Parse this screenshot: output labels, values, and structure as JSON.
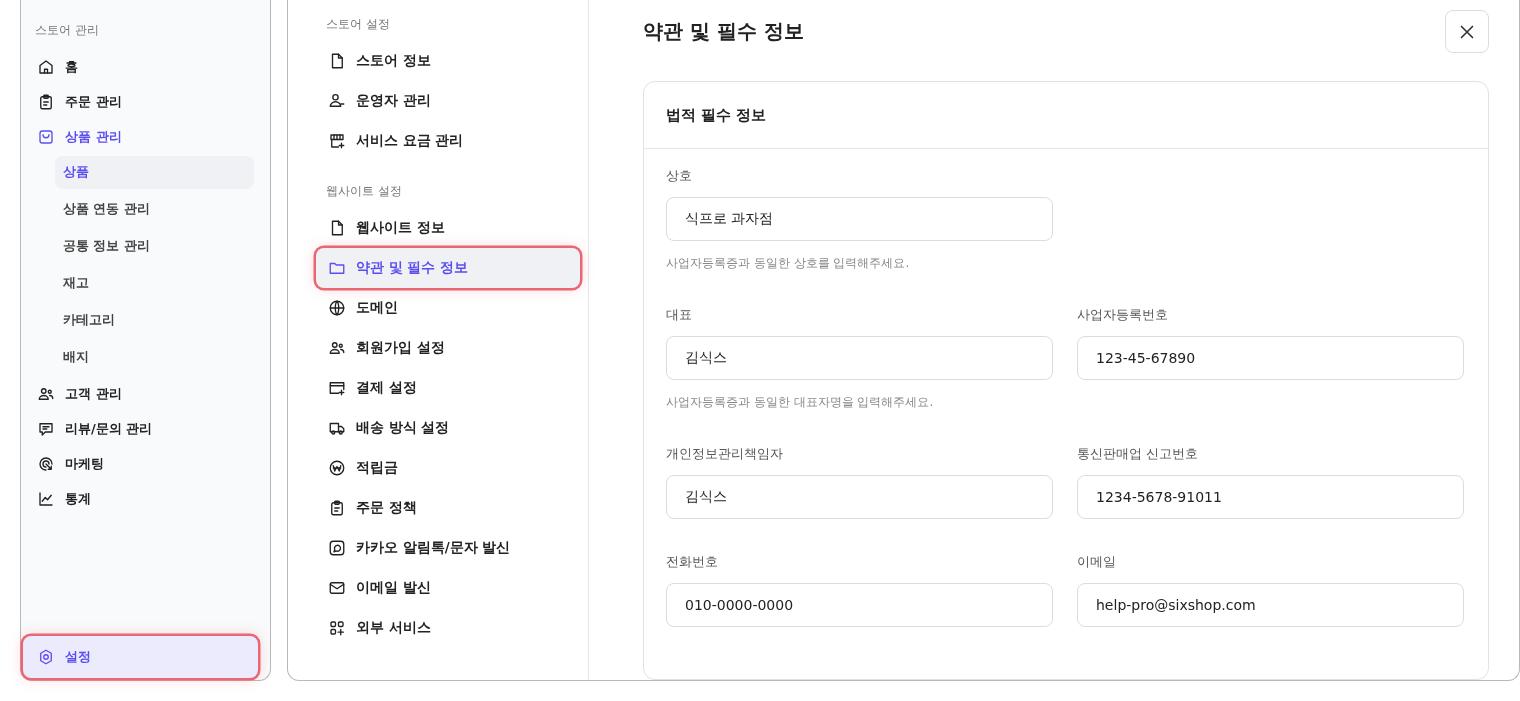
{
  "sidebar": {
    "section_label": "스토어 관리",
    "items": [
      {
        "label": "홈",
        "selected": false,
        "expanded": false
      },
      {
        "label": "주문 관리",
        "selected": false,
        "expanded": false
      },
      {
        "label": "상품 관리",
        "selected": false,
        "expanded": true,
        "children": [
          {
            "label": "상품",
            "selected": true
          },
          {
            "label": "상품 연동 관리",
            "selected": false
          },
          {
            "label": "공통 정보 관리",
            "selected": false
          },
          {
            "label": "재고",
            "selected": false
          },
          {
            "label": "카테고리",
            "selected": false
          },
          {
            "label": "배지",
            "selected": false
          }
        ]
      },
      {
        "label": "고객 관리",
        "selected": false,
        "expanded": false
      },
      {
        "label": "리뷰/문의 관리",
        "selected": false,
        "expanded": false
      },
      {
        "label": "마케팅",
        "selected": false,
        "expanded": false
      },
      {
        "label": "통계",
        "selected": false,
        "expanded": false
      }
    ],
    "footer_item": {
      "label": "설정",
      "selected": true,
      "highlighted": true
    }
  },
  "settings_nav": [
    {
      "label": "스토어 설정",
      "items": [
        {
          "label": "스토어 정보",
          "selected": false,
          "highlighted": false
        },
        {
          "label": "운영자 관리",
          "selected": false,
          "highlighted": false
        },
        {
          "label": "서비스 요금 관리",
          "selected": false,
          "highlighted": false
        }
      ]
    },
    {
      "label": "웹사이트 설정",
      "items": [
        {
          "label": "웹사이트 정보",
          "selected": false,
          "highlighted": false
        },
        {
          "label": "약관 및 필수 정보",
          "selected": true,
          "highlighted": true
        },
        {
          "label": "도메인",
          "selected": false,
          "highlighted": false
        },
        {
          "label": "회원가입 설정",
          "selected": false,
          "highlighted": false
        },
        {
          "label": "결제 설정",
          "selected": false,
          "highlighted": false
        },
        {
          "label": "배송 방식 설정",
          "selected": false,
          "highlighted": false
        },
        {
          "label": "적립금",
          "selected": false,
          "highlighted": false
        },
        {
          "label": "주문 정책",
          "selected": false,
          "highlighted": false
        },
        {
          "label": "카카오 알림톡/문자 발신",
          "selected": false,
          "highlighted": false
        },
        {
          "label": "이메일 발신",
          "selected": false,
          "highlighted": false
        },
        {
          "label": "외부 서비스",
          "selected": false,
          "highlighted": false
        }
      ]
    }
  ],
  "content": {
    "title": "약관 및 필수 정보",
    "card": {
      "title": "법적 필수 정보",
      "rows": [
        {
          "fields": [
            {
              "label": "상호",
              "value": "식프로 과자점",
              "help": "사업자등록증과 동일한 상호를 입력해주세요."
            }
          ]
        },
        {
          "fields": [
            {
              "label": "대표",
              "value": "김식스",
              "help": "사업자등록증과 동일한 대표자명을 입력해주세요."
            },
            {
              "label": "사업자등록번호",
              "value": "123-45-67890"
            }
          ]
        },
        {
          "fields": [
            {
              "label": "개인정보관리책임자",
              "value": "김식스"
            },
            {
              "label": "통신판매업 신고번호",
              "value": "1234-5678-91011"
            }
          ]
        },
        {
          "fields": [
            {
              "label": "전화번호",
              "value": "010-0000-0000"
            },
            {
              "label": "이메일",
              "value": "help-pro@sixshop.com"
            }
          ]
        }
      ]
    }
  }
}
